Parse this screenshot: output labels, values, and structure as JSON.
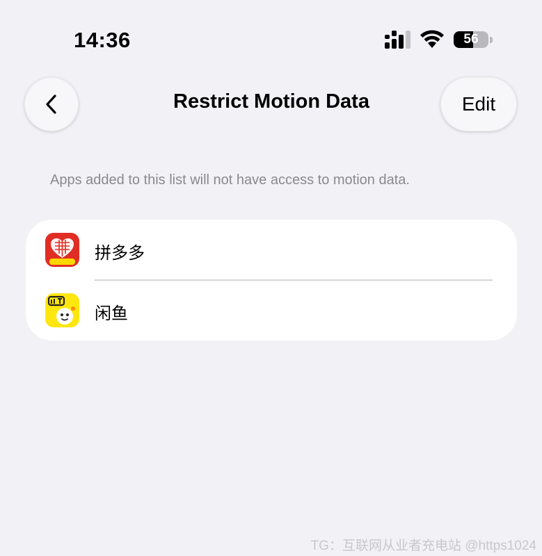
{
  "status_bar": {
    "time": "14:36",
    "battery_level": "56",
    "icons": [
      "cellular-signal-icon",
      "wifi-icon",
      "battery-icon"
    ]
  },
  "nav": {
    "back_icon": "chevron-left-icon",
    "title": "Restrict Motion Data",
    "edit_label": "Edit"
  },
  "description": "Apps added to this list will not have access to motion data.",
  "apps": [
    {
      "name": "拼多多",
      "icon": "pinduoduo-app-icon",
      "icon_text": "11.11",
      "color": "#e02e24"
    },
    {
      "name": "闲鱼",
      "icon": "xianyu-app-icon",
      "icon_text": "闲鱼",
      "color": "#ffe60f"
    }
  ],
  "watermark": "TG：互联网从业者充电站 @https1024",
  "colors": {
    "background": "#f2f1f6",
    "card": "#ffffff",
    "secondary_text": "#8a8a8e"
  }
}
